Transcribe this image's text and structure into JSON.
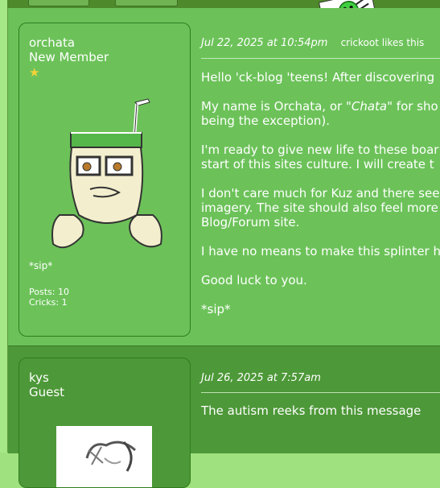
{
  "posts": [
    {
      "author": {
        "name": "orchata",
        "role": "New Member",
        "rank_icon": "star-icon",
        "signature": "*sip*",
        "posts_label": "Posts: 10",
        "cricks_label": "Cricks: 1"
      },
      "date": "Jul 22, 2025 at 10:54pm",
      "likes": "crickoot likes this",
      "paragraphs": [
        [
          "Hello 'ck-blog 'teens! After discovering "
        ],
        [
          "My name is Orchata, or ",
          "\"Chata\"",
          " for sho"
        ],
        [
          "being the exception)."
        ],
        [
          "I'm ready to give new life to these boar"
        ],
        [
          "start of this sites culture. I will create t"
        ],
        [
          "I don't care much for Kuz and there see"
        ],
        [
          "imagery. The site should also feel more"
        ],
        [
          "Blog/Forum site."
        ],
        [
          "I have no means to make this splinter h"
        ],
        [
          "Good luck to you."
        ],
        [
          "*sip*"
        ]
      ]
    },
    {
      "author": {
        "name": "kys",
        "role": "Guest"
      },
      "date": "Jul 26, 2025 at 7:57am",
      "body": "The autism reeks from this message"
    }
  ],
  "colors": {
    "post_bg_light": "#6cc259",
    "post_bg_dark": "#4d9838",
    "border": "#2f7d1e",
    "text": "#ffffff",
    "star": "#f5d23a"
  }
}
